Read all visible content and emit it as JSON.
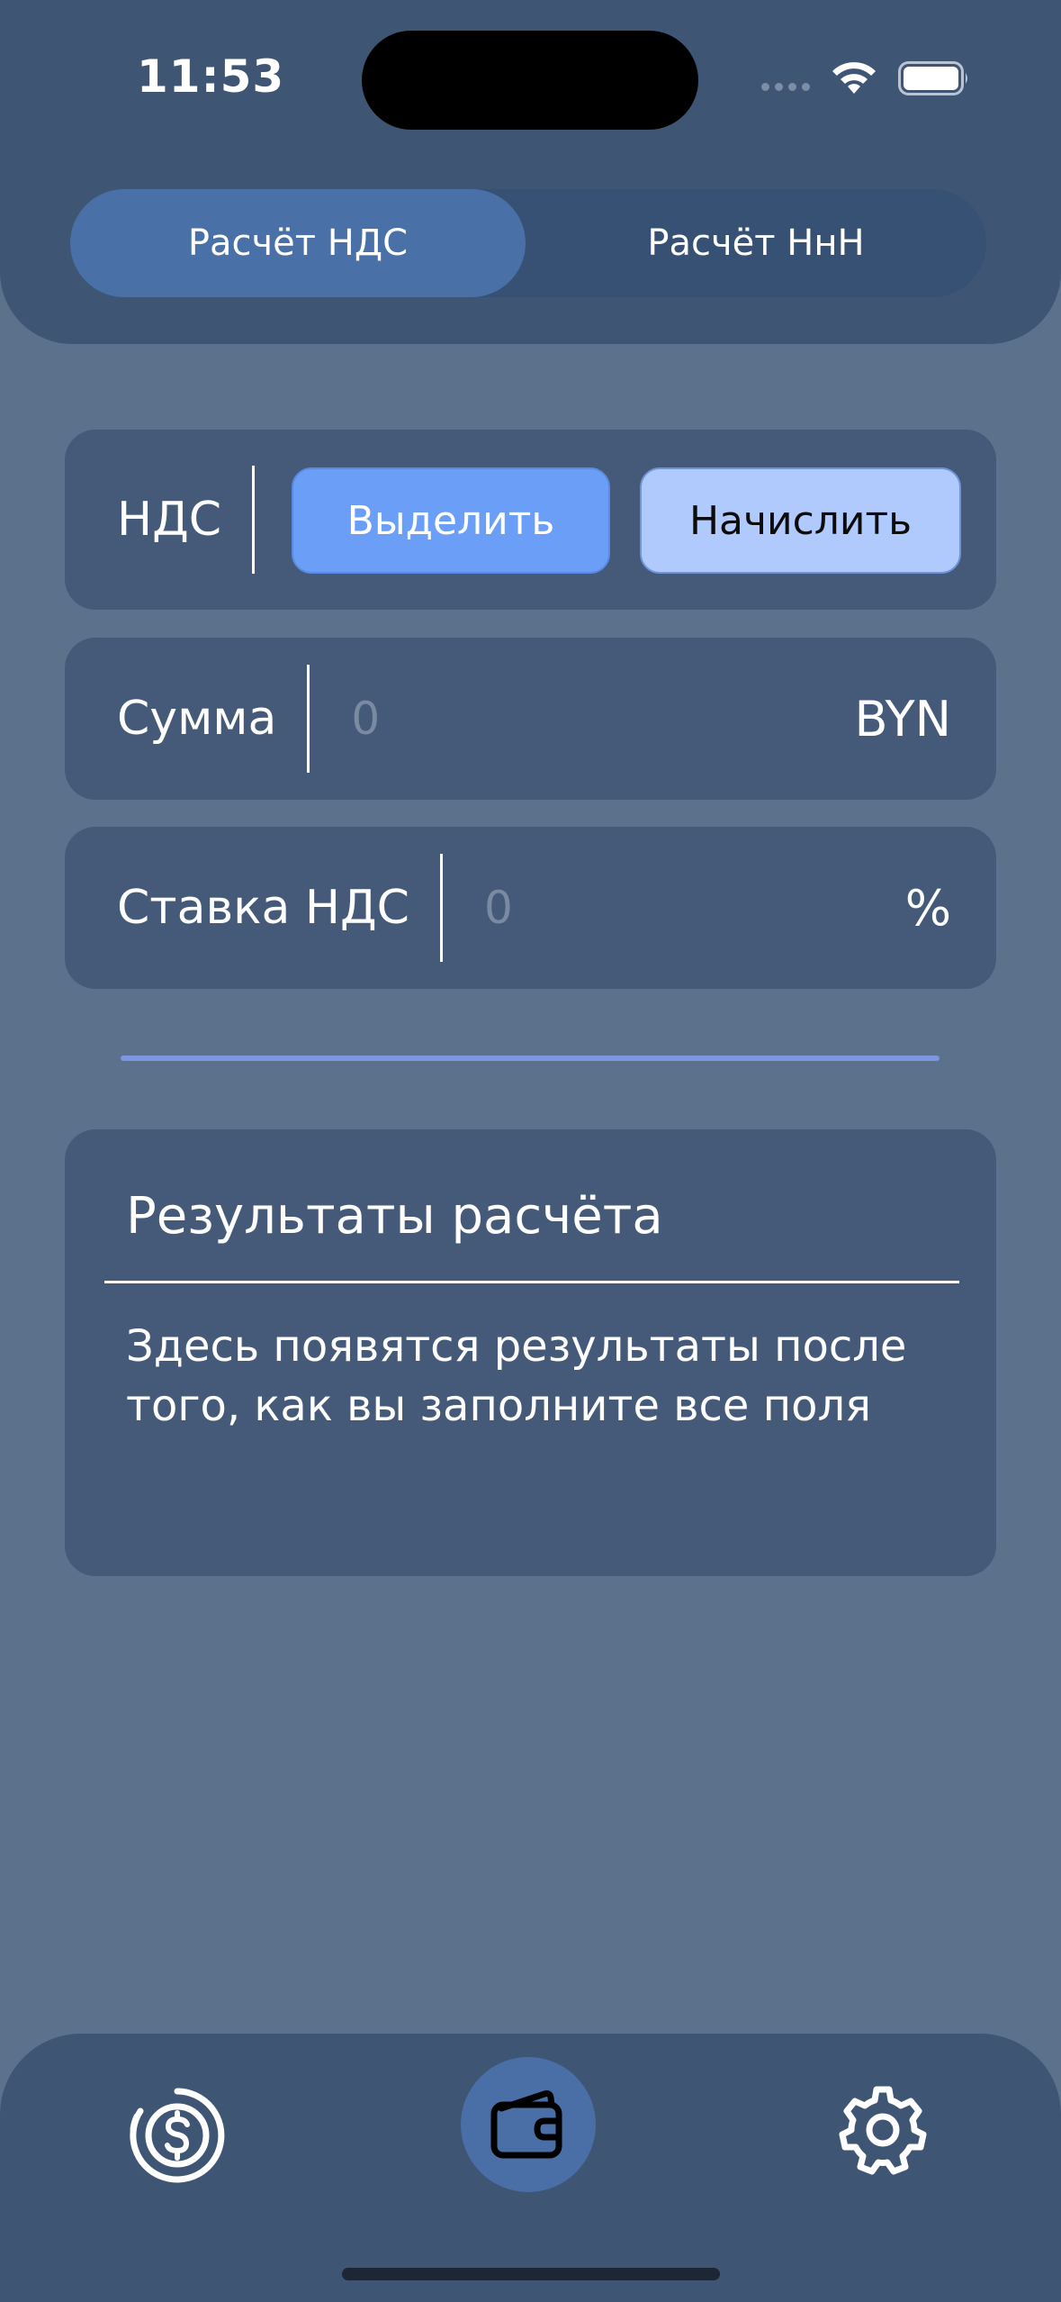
{
  "status_bar": {
    "time": "11:53",
    "icons": [
      "signal-dots-icon",
      "wifi-icon",
      "battery-icon"
    ]
  },
  "segmented_control": {
    "options": [
      "Расчёт НДС",
      "Расчёт НнН"
    ],
    "selected": "Расчёт НДС"
  },
  "vat_mode": {
    "label": "НДС",
    "buttons": [
      "Выделить",
      "Начислить"
    ]
  },
  "amount": {
    "label": "Сумма",
    "placeholder": "0",
    "unit": "BYN"
  },
  "rate": {
    "label": "Ставка НДС",
    "placeholder": "0",
    "unit": "%"
  },
  "results": {
    "title": "Результаты расчёта",
    "message": "Здесь появятся результаты после того, как вы заполните все поля"
  },
  "tab_bar": {
    "items": [
      {
        "icon": "dollar-circle-icon"
      },
      {
        "icon": "wallet-icon",
        "selected": true
      },
      {
        "icon": "gear-icon"
      }
    ]
  },
  "colors": {
    "background": "#5c718c",
    "panel": "#3f5574",
    "card": "#445a78",
    "accent_blue": "#6b9ef6",
    "light_blue": "#b0cafe",
    "selected_tab": "#4970a7"
  }
}
